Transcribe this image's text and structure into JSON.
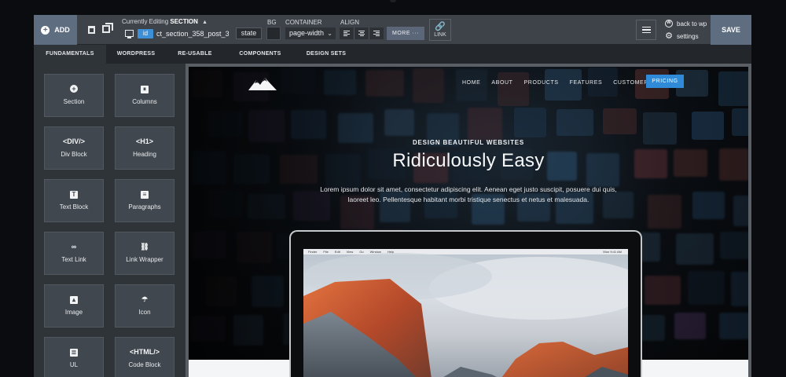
{
  "toolbar": {
    "add_label": "ADD",
    "editing_prefix": "Currently Editing",
    "editing_target": "SECTION",
    "id_badge": "id",
    "selector": "ct_section_358_post_3(",
    "state_label": "state",
    "bg_label": "BG",
    "container_label": "CONTAINER",
    "container_value": "page-width",
    "align_label": "ALIGN",
    "more_label": "MORE ···",
    "link_label": "LINK",
    "back_to_wp": "back to wp",
    "settings": "settings",
    "save_label": "SAVE"
  },
  "tabs": [
    {
      "label": "FUNDAMENTALS",
      "active": true
    },
    {
      "label": "WORDPRESS",
      "active": false
    },
    {
      "label": "RE-USABLE",
      "active": false
    },
    {
      "label": "COMPONENTS",
      "active": false
    },
    {
      "label": "DESIGN SETS",
      "active": false
    }
  ],
  "elements": [
    {
      "icon": "⊕",
      "label": "Section",
      "icon_name": "plus-circle-icon"
    },
    {
      "icon": "⏸",
      "label": "Columns",
      "icon_name": "columns-icon"
    },
    {
      "icon": "<DIV/>",
      "label": "Div Block",
      "icon_name": "div-tag-icon"
    },
    {
      "icon": "<H1>",
      "label": "Heading",
      "icon_name": "h1-tag-icon"
    },
    {
      "icon": "T",
      "label": "Text Block",
      "icon_name": "text-icon"
    },
    {
      "icon": "≡",
      "label": "Paragraphs",
      "icon_name": "paragraph-icon"
    },
    {
      "icon": "∞",
      "label": "Text Link",
      "icon_name": "link-icon"
    },
    {
      "icon": "🔗",
      "label": "Link Wrapper",
      "icon_name": "link-wrapper-icon"
    },
    {
      "icon": "▣",
      "label": "Image",
      "icon_name": "image-icon"
    },
    {
      "icon": "☂",
      "label": "Icon",
      "icon_name": "umbrella-icon"
    },
    {
      "icon": "≣",
      "label": "UL",
      "icon_name": "list-icon"
    },
    {
      "icon": "<HTML/>",
      "label": "Code Block",
      "icon_name": "html-tag-icon"
    }
  ],
  "site": {
    "nav": [
      "HOME",
      "ABOUT",
      "PRODUCTS",
      "FEATURES",
      "CUSTOMERS"
    ],
    "pricing": "PRICING",
    "eyebrow": "DESIGN BEAUTIFUL WEBSITES",
    "title": "Ridiculously Easy",
    "body": "Lorem ipsum dolor sit amet, consectetur adipiscing elit. Aenean eget justo suscipit, posuere dui quis, laoreet leo. Pellentesque habitant morbi tristique senectus et netus et malesuada.",
    "menubar": [
      "Finder",
      "File",
      "Edit",
      "View",
      "Go",
      "Window",
      "Help"
    ],
    "clock": "Mon 9:41 AM"
  },
  "colors": {
    "accent": "#2f8bd8",
    "toolbar": "#3e434a",
    "panel": "#2f3439",
    "save": "#5f6d80"
  }
}
